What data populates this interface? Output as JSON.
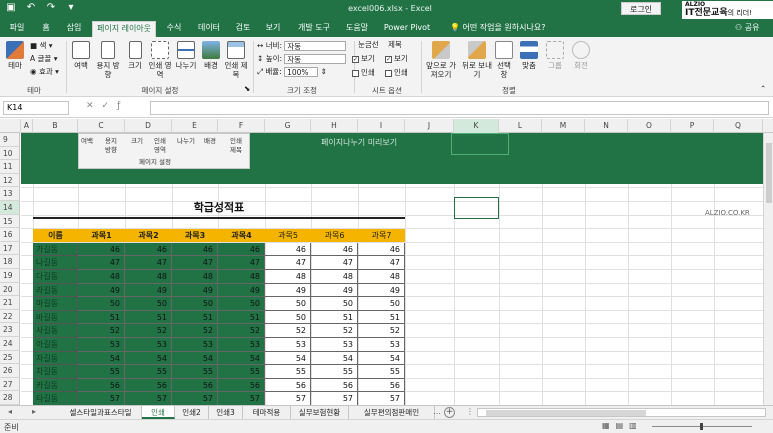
{
  "titlebar": {
    "window_title": "excel006.xlsx  -  Excel",
    "login_label": "로그인",
    "brand_top": "ALZIO",
    "brand_main": "IT전문교육",
    "brand_suffix": "의 리더!"
  },
  "tabs": [
    "파일",
    "홈",
    "삽입",
    "페이지 레이아웃",
    "수식",
    "데이터",
    "검토",
    "보기",
    "개발 도구",
    "도움말",
    "Power Pivot"
  ],
  "active_tab_index": 3,
  "tell_me": "어떤 작업을 원하시나요?",
  "share_label": "공유",
  "ribbon": {
    "theme_group": {
      "label": "테마",
      "buttons": [
        "테마",
        "색",
        "글꼴",
        "효과"
      ]
    },
    "page_setup_group": {
      "label": "페이지 설정",
      "buttons": [
        "여백",
        "용지 방향",
        "크기",
        "인쇄 영역",
        "나누기",
        "배경",
        "인쇄 제목"
      ]
    },
    "scale_group": {
      "label": "크기 조정",
      "width_label": "너비:",
      "width_value": "자동",
      "height_label": "높이:",
      "height_value": "자동",
      "scale_label": "배율:",
      "scale_value": "100%"
    },
    "sheet_options_group": {
      "label": "시트 옵션",
      "gridlines_label": "눈금선",
      "headings_label": "제목",
      "view_label": "보기",
      "print_label": "인쇄"
    },
    "arrange_group": {
      "label": "정렬",
      "buttons": [
        "앞으로 가져오기",
        "뒤로 보내기",
        "선택 창",
        "맞춤",
        "그룹",
        "회전"
      ]
    }
  },
  "formula_bar": {
    "name_box": "K14",
    "formula": ""
  },
  "columns": [
    "A",
    "B",
    "C",
    "D",
    "E",
    "F",
    "G",
    "H",
    "I",
    "J",
    "K",
    "L",
    "M",
    "N",
    "O",
    "P",
    "Q"
  ],
  "rows": [
    "9",
    "10",
    "11",
    "12",
    "13",
    "14",
    "15",
    "16",
    "17",
    "18",
    "19",
    "20",
    "21",
    "22",
    "23",
    "24",
    "25",
    "26",
    "27",
    "28"
  ],
  "overlay": {
    "panel_row1": [
      "여백",
      "용지",
      "크기",
      "인쇄",
      "나누기",
      "배경",
      "인쇄"
    ],
    "panel_row2": [
      "",
      "방향",
      "",
      "영역",
      "",
      "",
      "제목"
    ],
    "panel_label": "페이지 설정",
    "ghost_text": "페이지나누기 미리보기"
  },
  "sheet": {
    "title": "학급성적표",
    "watermark": "ALZIO.CO.KR",
    "headers": [
      "이름",
      "과목1",
      "과목2",
      "과목3",
      "과목4",
      "과목5",
      "과목6",
      "과목7"
    ],
    "names": [
      "가길동",
      "나길동",
      "다길동",
      "라길동",
      "마길동",
      "바길동",
      "사길동",
      "아길동",
      "자길동",
      "차길동",
      "카길동",
      "타길동"
    ],
    "values": [
      [
        46,
        46,
        46,
        46,
        46,
        46,
        46
      ],
      [
        47,
        47,
        47,
        47,
        47,
        47,
        47
      ],
      [
        48,
        48,
        48,
        48,
        48,
        48,
        48
      ],
      [
        49,
        49,
        49,
        49,
        49,
        49,
        49
      ],
      [
        50,
        50,
        50,
        50,
        50,
        50,
        50
      ],
      [
        51,
        51,
        51,
        51,
        50,
        51,
        51
      ],
      [
        52,
        52,
        52,
        52,
        52,
        52,
        52
      ],
      [
        53,
        53,
        53,
        53,
        53,
        53,
        53
      ],
      [
        54,
        54,
        54,
        54,
        54,
        54,
        54
      ],
      [
        55,
        55,
        55,
        55,
        55,
        55,
        55
      ],
      [
        56,
        56,
        56,
        56,
        56,
        56,
        56
      ],
      [
        57,
        57,
        57,
        57,
        57,
        57,
        57
      ]
    ]
  },
  "sheet_tabs": [
    "셀스타일과표스타일",
    "인쇄",
    "인쇄2",
    "인쇄3",
    "테마적용",
    "실무보험현황",
    "실무편의점판매인"
  ],
  "active_sheet_index": 1,
  "status": {
    "ready": "준비"
  },
  "colors": {
    "excel_green": "#217346",
    "header_orange": "#f4b400"
  }
}
